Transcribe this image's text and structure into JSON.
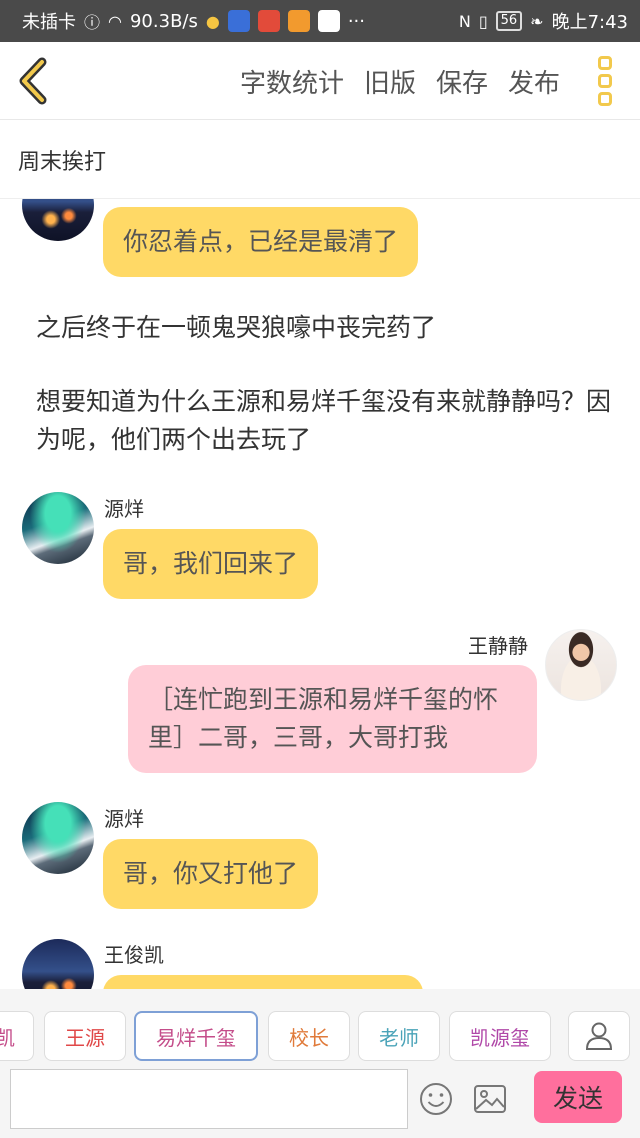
{
  "status_bar": {
    "carrier": "未插卡",
    "speed": "90.3B/s",
    "battery": "56",
    "time": "晚上7:43",
    "icons": [
      "sim-alert-icon",
      "wifi-icon",
      "bulb-icon",
      "baidu-icon",
      "app-icon",
      "play-icon",
      "qq-icon",
      "more-dots-icon",
      "nfc-icon",
      "vibrate-icon",
      "battery-icon",
      "leaf-icon"
    ]
  },
  "toolbar": {
    "word_count": "字数统计",
    "old_version": "旧版",
    "save": "保存",
    "publish": "发布"
  },
  "doc_title": "周末挨打",
  "messages": [
    {
      "speaker": "",
      "text": "你忍着点，已经是最清了",
      "avatar": "city-night"
    },
    {
      "narration": "之后终于在一顿鬼哭狼嚎中丧完药了"
    },
    {
      "narration": "想要知道为什么王源和易烊千玺没有来就静静吗？因为呢，他们两个出去玩了"
    },
    {
      "speaker": "源烊",
      "text": "哥，我们回来了",
      "avatar": "aurora"
    },
    {
      "speaker": "王静静",
      "text": "［连忙跑到王源和易烊千玺的怀里］二哥，三哥，大哥打我",
      "avatar": "girl"
    },
    {
      "speaker": "源烊",
      "text": "哥，你又打他了",
      "avatar": "aurora"
    },
    {
      "speaker": "王俊凯",
      "text": "",
      "avatar": "city-night"
    }
  ],
  "characters": [
    {
      "label": "凯",
      "color": "#c44d8a"
    },
    {
      "label": "王源",
      "color": "#e04848"
    },
    {
      "label": "易烊千玺",
      "color": "#c44d8a"
    },
    {
      "label": "校长",
      "color": "#e07a3a"
    },
    {
      "label": "老师",
      "color": "#4aa3b8"
    },
    {
      "label": "凯源玺",
      "color": "#b048a8"
    }
  ],
  "input": {
    "placeholder": "",
    "send": "发送"
  },
  "colors": {
    "accent_yellow": "#ffd966",
    "bubble_pink": "#ffcdd7",
    "send_pink": "#ff6f9d",
    "status_bar": "#4a4a4a"
  }
}
